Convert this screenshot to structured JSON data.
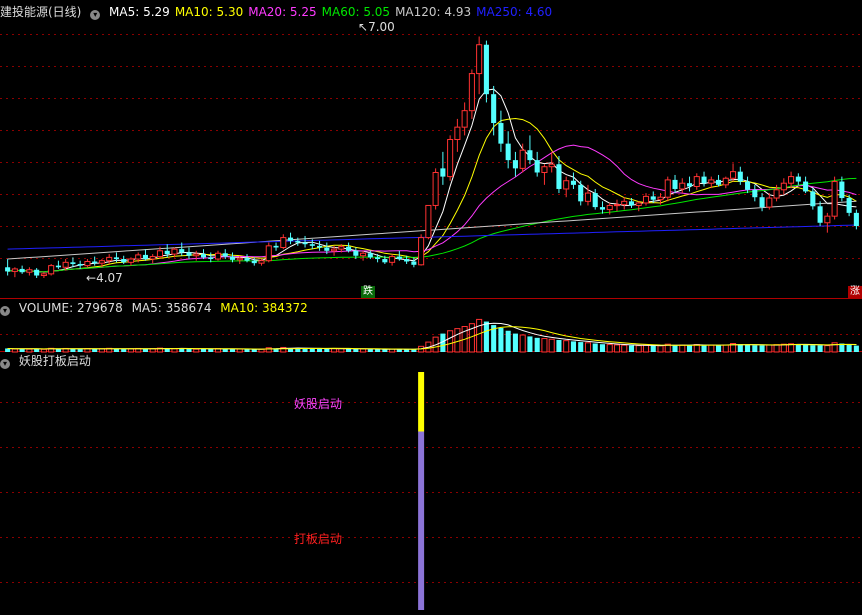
{
  "price_header": {
    "stock": "建投能源(日线)",
    "ma": [
      {
        "label": "MA5: ",
        "value": "5.29",
        "color": "#ffffff"
      },
      {
        "label": "MA10: ",
        "value": "5.30",
        "color": "#ffff00"
      },
      {
        "label": "MA20: ",
        "value": "5.25",
        "color": "#ff3bff"
      },
      {
        "label": "MA60: ",
        "value": "5.05",
        "color": "#00e600"
      },
      {
        "label": "MA120: ",
        "value": "4.93",
        "color": "#c8c8c8"
      },
      {
        "label": "MA250: ",
        "value": "4.60",
        "color": "#2020ff"
      }
    ]
  },
  "volume_header": {
    "label": "VOLUME: ",
    "value": "279678",
    "ma5_label": "MA5: ",
    "ma5_value": "358674",
    "ma10_label": "MA10: ",
    "ma10_value": "384372"
  },
  "indicator_header": {
    "name": "妖股打板启动"
  },
  "annotations": {
    "high": "7.00",
    "low": "4.07",
    "fall_tag": "跌",
    "rise_tag": "涨",
    "signal1": "妖股启动",
    "signal2": "打板启动"
  },
  "colors": {
    "up": "#ff3232",
    "down": "#54ffff",
    "grid": "#8b0000",
    "signal_yellow": "#ffff00",
    "signal_purple": "#8c74d8",
    "signal1_text": "#ff44ff",
    "signal2_text": "#ff2020"
  },
  "chart_data": {
    "type": "candlestick",
    "series_count": 118,
    "ylim": [
      3.9,
      7.2
    ],
    "candles": [
      [
        4.2,
        4.3,
        4.1,
        4.15
      ],
      [
        4.15,
        4.2,
        4.08,
        4.18
      ],
      [
        4.18,
        4.22,
        4.12,
        4.14
      ],
      [
        4.14,
        4.2,
        4.1,
        4.17
      ],
      [
        4.17,
        4.19,
        4.07,
        4.1
      ],
      [
        4.1,
        4.14,
        4.07,
        4.12
      ],
      [
        4.12,
        4.24,
        4.1,
        4.22
      ],
      [
        4.22,
        4.28,
        4.18,
        4.2
      ],
      [
        4.2,
        4.3,
        4.16,
        4.26
      ],
      [
        4.26,
        4.32,
        4.2,
        4.24
      ],
      [
        4.24,
        4.28,
        4.18,
        4.22
      ],
      [
        4.22,
        4.3,
        4.2,
        4.27
      ],
      [
        4.27,
        4.33,
        4.22,
        4.25
      ],
      [
        4.25,
        4.3,
        4.2,
        4.28
      ],
      [
        4.28,
        4.36,
        4.24,
        4.32
      ],
      [
        4.32,
        4.38,
        4.26,
        4.3
      ],
      [
        4.3,
        4.34,
        4.24,
        4.26
      ],
      [
        4.26,
        4.32,
        4.22,
        4.3
      ],
      [
        4.3,
        4.38,
        4.26,
        4.35
      ],
      [
        4.35,
        4.42,
        4.28,
        4.3
      ],
      [
        4.3,
        4.36,
        4.25,
        4.33
      ],
      [
        4.33,
        4.45,
        4.3,
        4.4
      ],
      [
        4.4,
        4.48,
        4.32,
        4.36
      ],
      [
        4.36,
        4.44,
        4.32,
        4.42
      ],
      [
        4.42,
        4.5,
        4.34,
        4.38
      ],
      [
        4.38,
        4.44,
        4.3,
        4.34
      ],
      [
        4.34,
        4.4,
        4.28,
        4.36
      ],
      [
        4.36,
        4.42,
        4.3,
        4.32
      ],
      [
        4.32,
        4.38,
        4.26,
        4.3
      ],
      [
        4.3,
        4.4,
        4.28,
        4.37
      ],
      [
        4.37,
        4.42,
        4.3,
        4.33
      ],
      [
        4.33,
        4.38,
        4.26,
        4.29
      ],
      [
        4.29,
        4.34,
        4.24,
        4.31
      ],
      [
        4.31,
        4.36,
        4.26,
        4.28
      ],
      [
        4.28,
        4.32,
        4.22,
        4.25
      ],
      [
        4.25,
        4.3,
        4.22,
        4.28
      ],
      [
        4.28,
        4.5,
        4.26,
        4.46
      ],
      [
        4.46,
        4.5,
        4.4,
        4.44
      ],
      [
        4.44,
        4.6,
        4.42,
        4.56
      ],
      [
        4.56,
        4.62,
        4.48,
        4.52
      ],
      [
        4.52,
        4.56,
        4.46,
        4.5
      ],
      [
        4.5,
        4.58,
        4.44,
        4.48
      ],
      [
        4.48,
        4.54,
        4.42,
        4.46
      ],
      [
        4.46,
        4.52,
        4.4,
        4.44
      ],
      [
        4.44,
        4.5,
        4.36,
        4.4
      ],
      [
        4.4,
        4.46,
        4.34,
        4.42
      ],
      [
        4.42,
        4.48,
        4.38,
        4.45
      ],
      [
        4.45,
        4.5,
        4.38,
        4.4
      ],
      [
        4.4,
        4.44,
        4.3,
        4.34
      ],
      [
        4.34,
        4.4,
        4.28,
        4.37
      ],
      [
        4.37,
        4.4,
        4.3,
        4.32
      ],
      [
        4.32,
        4.36,
        4.26,
        4.3
      ],
      [
        4.3,
        4.34,
        4.24,
        4.26
      ],
      [
        4.26,
        4.36,
        4.22,
        4.33
      ],
      [
        4.33,
        4.4,
        4.28,
        4.3
      ],
      [
        4.3,
        4.34,
        4.24,
        4.27
      ],
      [
        4.27,
        4.32,
        4.2,
        4.23
      ],
      [
        4.23,
        4.6,
        4.22,
        4.56
      ],
      [
        4.56,
        4.95,
        4.54,
        4.95
      ],
      [
        4.95,
        5.4,
        4.9,
        5.35
      ],
      [
        5.4,
        5.6,
        5.2,
        5.3
      ],
      [
        5.3,
        5.8,
        5.25,
        5.75
      ],
      [
        5.75,
        6.0,
        5.6,
        5.9
      ],
      [
        5.9,
        6.2,
        5.8,
        6.1
      ],
      [
        6.1,
        6.6,
        6.0,
        6.55
      ],
      [
        6.55,
        7.0,
        6.3,
        6.9
      ],
      [
        6.9,
        6.95,
        6.2,
        6.3
      ],
      [
        6.3,
        6.4,
        5.8,
        5.95
      ],
      [
        5.95,
        6.1,
        5.6,
        5.7
      ],
      [
        5.7,
        5.85,
        5.4,
        5.5
      ],
      [
        5.5,
        5.6,
        5.3,
        5.4
      ],
      [
        5.4,
        5.7,
        5.35,
        5.62
      ],
      [
        5.62,
        5.8,
        5.45,
        5.5
      ],
      [
        5.5,
        5.6,
        5.3,
        5.35
      ],
      [
        5.35,
        5.45,
        5.2,
        5.42
      ],
      [
        5.42,
        5.6,
        5.35,
        5.45
      ],
      [
        5.45,
        5.55,
        5.1,
        5.15
      ],
      [
        5.15,
        5.3,
        5.05,
        5.25
      ],
      [
        5.25,
        5.35,
        5.15,
        5.2
      ],
      [
        5.2,
        5.25,
        4.95,
        5.0
      ],
      [
        5.0,
        5.2,
        4.95,
        5.1
      ],
      [
        5.1,
        5.15,
        4.9,
        4.93
      ],
      [
        4.93,
        5.0,
        4.85,
        4.9
      ],
      [
        4.9,
        4.98,
        4.84,
        4.95
      ],
      [
        4.95,
        5.02,
        4.88,
        4.96
      ],
      [
        4.96,
        5.05,
        4.9,
        5.0
      ],
      [
        5.0,
        5.04,
        4.92,
        4.95
      ],
      [
        4.95,
        5.0,
        4.88,
        4.98
      ],
      [
        4.98,
        5.1,
        4.95,
        5.06
      ],
      [
        5.06,
        5.12,
        4.98,
        5.02
      ],
      [
        5.02,
        5.1,
        4.96,
        5.05
      ],
      [
        5.05,
        5.3,
        5.0,
        5.26
      ],
      [
        5.26,
        5.32,
        5.1,
        5.15
      ],
      [
        5.15,
        5.28,
        5.1,
        5.22
      ],
      [
        5.22,
        5.3,
        5.12,
        5.18
      ],
      [
        5.18,
        5.34,
        5.14,
        5.3
      ],
      [
        5.3,
        5.36,
        5.18,
        5.22
      ],
      [
        5.22,
        5.3,
        5.16,
        5.26
      ],
      [
        5.26,
        5.32,
        5.18,
        5.2
      ],
      [
        5.2,
        5.3,
        5.16,
        5.28
      ],
      [
        5.28,
        5.46,
        5.24,
        5.36
      ],
      [
        5.36,
        5.42,
        5.2,
        5.24
      ],
      [
        5.24,
        5.3,
        5.1,
        5.14
      ],
      [
        5.14,
        5.2,
        5.0,
        5.05
      ],
      [
        5.05,
        5.1,
        4.88,
        4.93
      ],
      [
        4.93,
        5.1,
        4.9,
        5.04
      ],
      [
        5.04,
        5.2,
        5.0,
        5.14
      ],
      [
        5.14,
        5.28,
        5.08,
        5.22
      ],
      [
        5.22,
        5.36,
        5.16,
        5.3
      ],
      [
        5.3,
        5.34,
        5.2,
        5.24
      ],
      [
        5.24,
        5.3,
        5.1,
        5.12
      ],
      [
        5.12,
        5.16,
        4.9,
        4.94
      ],
      [
        4.94,
        5.0,
        4.7,
        4.74
      ],
      [
        4.74,
        4.86,
        4.62,
        4.82
      ],
      [
        4.82,
        5.3,
        4.78,
        5.24
      ],
      [
        5.24,
        5.3,
        5.0,
        5.04
      ],
      [
        5.04,
        5.08,
        4.82,
        4.86
      ],
      [
        4.86,
        4.9,
        4.66,
        4.7
      ]
    ],
    "ma_series": [
      {
        "name": "MA5",
        "color": "#ffffff"
      },
      {
        "name": "MA10",
        "color": "#ffff00"
      },
      {
        "name": "MA20",
        "color": "#ff3bff"
      },
      {
        "name": "MA60",
        "color": "#00e600"
      },
      {
        "name": "MA120",
        "color": "#c8c8c8"
      },
      {
        "name": "MA250",
        "color": "#2020ff"
      }
    ],
    "volume": [
      50,
      42,
      48,
      40,
      45,
      38,
      52,
      46,
      50,
      44,
      40,
      48,
      43,
      46,
      52,
      47,
      40,
      45,
      50,
      44,
      48,
      55,
      50,
      46,
      52,
      44,
      40,
      46,
      42,
      48,
      44,
      40,
      42,
      38,
      36,
      40,
      60,
      52,
      64,
      55,
      50,
      52,
      48,
      46,
      44,
      48,
      50,
      46,
      42,
      44,
      40,
      38,
      36,
      42,
      40,
      38,
      36,
      80,
      140,
      210,
      260,
      300,
      330,
      360,
      400,
      460,
      430,
      380,
      340,
      300,
      260,
      240,
      220,
      200,
      190,
      180,
      170,
      160,
      150,
      140,
      130,
      120,
      110,
      105,
      100,
      96,
      92,
      90,
      94,
      90,
      88,
      110,
      100,
      96,
      94,
      105,
      100,
      96,
      92,
      98,
      120,
      110,
      100,
      96,
      92,
      98,
      104,
      110,
      116,
      108,
      100,
      96,
      94,
      90,
      130,
      120,
      100,
      90
    ],
    "volume_ylim": [
      0,
      480
    ],
    "indicator": {
      "signal_index": 57,
      "yellow_fraction": 0.25,
      "labels": [
        "妖股启动",
        "打板启动"
      ]
    }
  }
}
